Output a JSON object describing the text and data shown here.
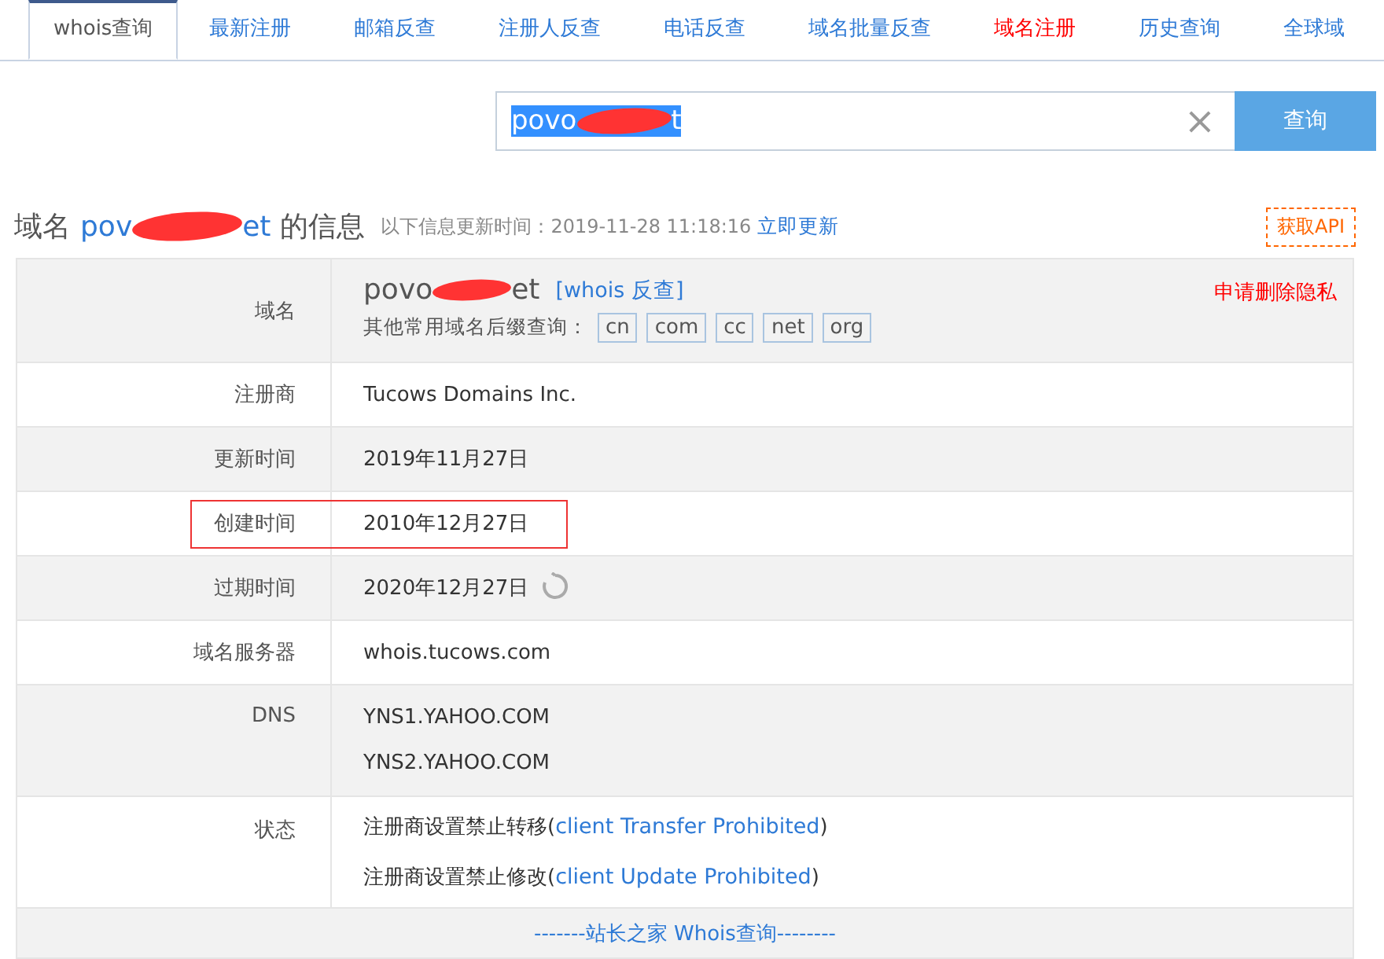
{
  "tabs": [
    {
      "label": "whois查询",
      "selected": true,
      "kind": "normal"
    },
    {
      "label": "最新注册",
      "selected": false,
      "kind": "normal"
    },
    {
      "label": "邮箱反查",
      "selected": false,
      "kind": "normal"
    },
    {
      "label": "注册人反查",
      "selected": false,
      "kind": "normal"
    },
    {
      "label": "电话反查",
      "selected": false,
      "kind": "normal"
    },
    {
      "label": "域名批量反查",
      "selected": false,
      "kind": "normal"
    },
    {
      "label": "域名注册",
      "selected": false,
      "kind": "promo"
    },
    {
      "label": "历史查询",
      "selected": false,
      "kind": "normal"
    },
    {
      "label": "全球域",
      "selected": false,
      "kind": "normal"
    }
  ],
  "search": {
    "value_start": "povo",
    "value_end": "t",
    "clear": "×",
    "button": "查询"
  },
  "heading": {
    "prefix": "域名",
    "domain_start": "pov",
    "domain_end": "et",
    "suffix": "的信息",
    "updated": "以下信息更新时间：2019-11-28 11:18:16",
    "refresh_link": "立即更新",
    "api_button": "获取API"
  },
  "domain_row": {
    "label": "域名",
    "domain_start": "povo",
    "domain_end": "et",
    "reverse_link": "[whois 反查]",
    "privacy_link": "申请删除隐私",
    "suffix_label": "其他常用域名后缀查询：",
    "suffixes": [
      "cn",
      "com",
      "cc",
      "net",
      "org"
    ]
  },
  "rows": [
    {
      "label": "注册商",
      "values": [
        "Tucows Domains Inc."
      ],
      "highlighted": false,
      "refresh": false
    },
    {
      "label": "更新时间",
      "values": [
        "2019年11月27日"
      ],
      "highlighted": false,
      "refresh": false
    },
    {
      "label": "创建时间",
      "values": [
        "2010年12月27日"
      ],
      "highlighted": true,
      "refresh": false
    },
    {
      "label": "过期时间",
      "values": [
        "2020年12月27日"
      ],
      "highlighted": false,
      "refresh": true
    },
    {
      "label": "域名服务器",
      "values": [
        "whois.tucows.com"
      ],
      "highlighted": false,
      "refresh": false
    },
    {
      "label": "DNS",
      "values": [
        "YNS1.YAHOO.COM",
        "YNS2.YAHOO.COM"
      ],
      "highlighted": false,
      "refresh": false
    }
  ],
  "status": {
    "label": "状态",
    "items": [
      {
        "text": "注册商设置禁止转移(",
        "link": "client Transfer Prohibited",
        "close": ")"
      },
      {
        "text": "注册商设置禁止修改(",
        "link": "client Update Prohibited",
        "close": ")"
      }
    ]
  },
  "footer": "-------站长之家 Whois查询--------"
}
